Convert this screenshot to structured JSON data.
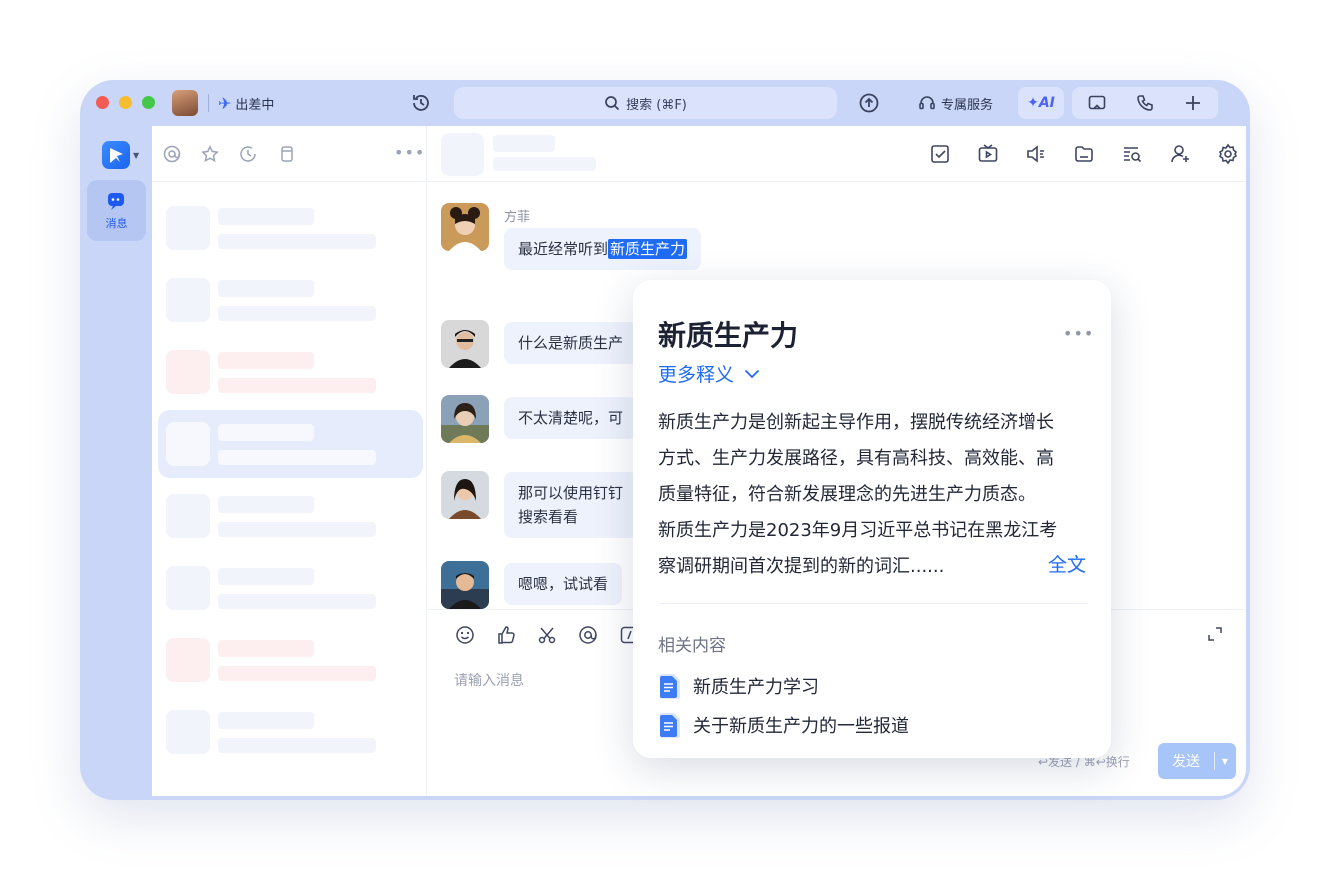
{
  "titlebar": {
    "status_label": "出差中",
    "search_placeholder": "搜索 (⌘F)",
    "service_label": "专属服务",
    "ai_label": "AI"
  },
  "rail": {
    "messages_label": "消息"
  },
  "chat": {
    "messages": [
      {
        "sender": "方菲",
        "text_before": "最近经常听到",
        "highlight": "新质生产力"
      },
      {
        "text": "什么是新质生产"
      },
      {
        "text": "不太清楚呢，可"
      },
      {
        "text_line1": "那可以使用钉钉",
        "text_line2": "搜索看看"
      },
      {
        "text": "嗯嗯，试试看"
      }
    ],
    "input_placeholder": "请输入消息",
    "send_hint": "↩发送 / ⌘↩换行",
    "send_label": "发送"
  },
  "popup": {
    "title": "新质生产力",
    "more_definitions": "更多释义",
    "definition_lines": [
      "新质生产力是创新起主导作用，摆脱传统经济增长",
      "方式、生产力发展路径，具有高科技、高效能、高",
      "质量特征，符合新发展理念的先进生产力质态。",
      "新质生产力是2023年9月习近平总书记在黑龙江考",
      "察调研期间首次提到的新的词汇......"
    ],
    "full_text_link": "全文",
    "related_heading": "相关内容",
    "related_items": [
      "新质生产力学习",
      "关于新质生产力的一些报道"
    ]
  },
  "colors": {
    "accent": "#1f6bf3",
    "window_frame": "#c9d6f7",
    "bubble": "#eef2fc",
    "send_button": "#a8c5f9"
  }
}
